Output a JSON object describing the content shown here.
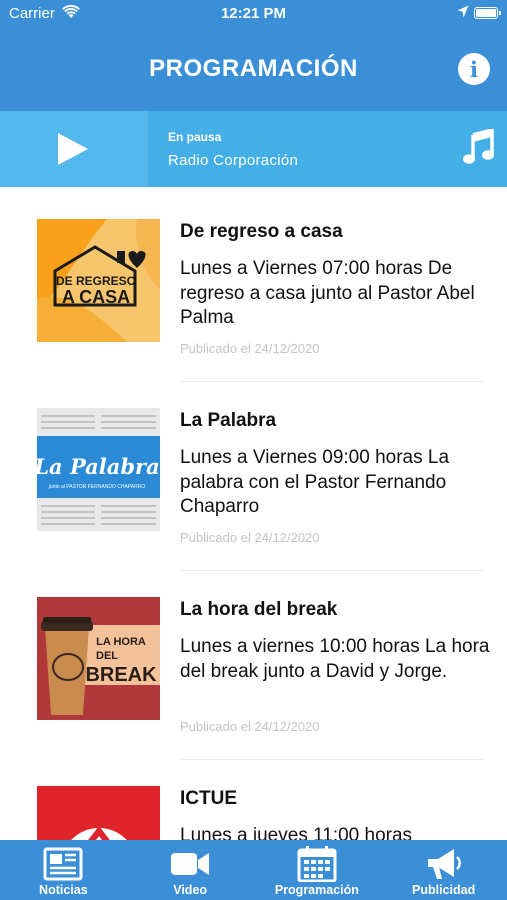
{
  "status_bar": {
    "carrier": "Carrier",
    "time": "12:21 PM"
  },
  "header": {
    "title": "PROGRAMACIÓN"
  },
  "player": {
    "status": "En pausa",
    "station": "Radio Corporación"
  },
  "programs": [
    {
      "title": "De regreso a casa",
      "description": "Lunes a Viernes 07:00 horas De regreso a casa junto al Pastor Abel Palma",
      "published": "Publicado el 24/12/2020",
      "thumb_text_1": "DE REGRESO",
      "thumb_text_2": "A CASA"
    },
    {
      "title": "La Palabra",
      "description": "Lunes a Viernes 09:00 horas La palabra con el Pastor Fernando Chaparro",
      "published": "Publicado el 24/12/2020",
      "thumb_text_1": "La Palabra",
      "thumb_text_2": "junto al PASTOR FERNANDO CHAPARRO"
    },
    {
      "title": "La hora del break",
      "description": "Lunes a viernes 10:00 horas La hora del break junto a David y Jorge.",
      "published": "Publicado el 24/12/2020",
      "thumb_text_1": "LA HORA",
      "thumb_text_2": "DEL",
      "thumb_text_3": "BREAK"
    },
    {
      "title": "ICTUE",
      "description": "Lunes a jueves 11:00 horas",
      "published": ""
    }
  ],
  "tabs": [
    {
      "label": "Noticias",
      "icon": "newspaper-icon"
    },
    {
      "label": "Video",
      "icon": "video-camera-icon"
    },
    {
      "label": "Programación",
      "icon": "calendar-icon"
    },
    {
      "label": "Publicidad",
      "icon": "megaphone-icon"
    }
  ],
  "colors": {
    "primary": "#3a8fd6",
    "player": "#44aee6",
    "thumb1": "#f9a11b",
    "thumb2": "#2a8ad6",
    "thumb3": "#b0383a",
    "thumb4": "#e0242b"
  }
}
